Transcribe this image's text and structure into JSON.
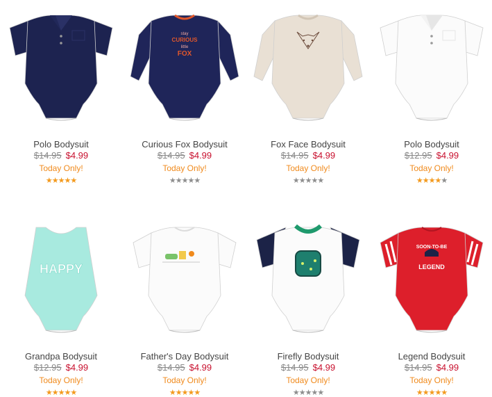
{
  "products": [
    {
      "name": "Polo Bodysuit",
      "was": "$14.95",
      "now": "$4.99",
      "promo": "Today Only!",
      "rating": 5,
      "rating_color": "#f39a1e",
      "colors": {
        "main": "#1d2350",
        "accent": "#2a3166"
      },
      "kind": "polo-short"
    },
    {
      "name": "Curious Fox Bodysuit",
      "was": "$14.95",
      "now": "$4.99",
      "promo": "Today Only!",
      "rating": 0,
      "rating_color": "#8e8e8e",
      "colors": {
        "main": "#1f2559",
        "accent": "#e0572b"
      },
      "kind": "long-sleeve",
      "art_lines": [
        "stay",
        "CURIOUS",
        "little",
        "FOX"
      ]
    },
    {
      "name": "Fox Face Bodysuit",
      "was": "$14.95",
      "now": "$4.99",
      "promo": "Today Only!",
      "rating": 0,
      "rating_color": "#8e8e8e",
      "colors": {
        "main": "#e9e0d4",
        "accent": "#6b4a3a"
      },
      "kind": "long-sleeve-fox"
    },
    {
      "name": "Polo Bodysuit",
      "was": "$12.95",
      "now": "$4.99",
      "promo": "Today Only!",
      "rating": 4,
      "rating_color": "#f39a1e",
      "colors": {
        "main": "#fbfbfb",
        "accent": "#e6e6e6"
      },
      "kind": "polo-short"
    },
    {
      "name": "Grandpa Bodysuit",
      "was": "$12.95",
      "now": "$4.99",
      "promo": "Today Only!",
      "rating": 5,
      "rating_color": "#f39a1e",
      "colors": {
        "main": "#a8eadf",
        "accent": "#7ed8c9"
      },
      "kind": "tank",
      "art_lines": [
        "HAPPY"
      ]
    },
    {
      "name": "Father's Day Bodysuit",
      "was": "$14.95",
      "now": "$4.99",
      "promo": "Today Only!",
      "rating": 5,
      "rating_color": "#f39a1e",
      "colors": {
        "main": "#fbfbfb",
        "accent": "#7ac36a"
      },
      "kind": "short-sleeve"
    },
    {
      "name": "Firefly Bodysuit",
      "was": "$14.95",
      "now": "$4.99",
      "promo": "Today Only!",
      "rating": 0,
      "rating_color": "#8e8e8e",
      "colors": {
        "main": "#fbfbfb",
        "accent": "#1c2347"
      },
      "kind": "raglan"
    },
    {
      "name": "Legend Bodysuit",
      "was": "$14.95",
      "now": "$4.99",
      "promo": "Today Only!",
      "rating": 5,
      "rating_color": "#f39a1e",
      "colors": {
        "main": "#dd1f2b",
        "accent": "#ffffff"
      },
      "kind": "stripe-sleeve",
      "art_lines": [
        "SOON-TO-BE",
        "LEGEND"
      ]
    }
  ]
}
